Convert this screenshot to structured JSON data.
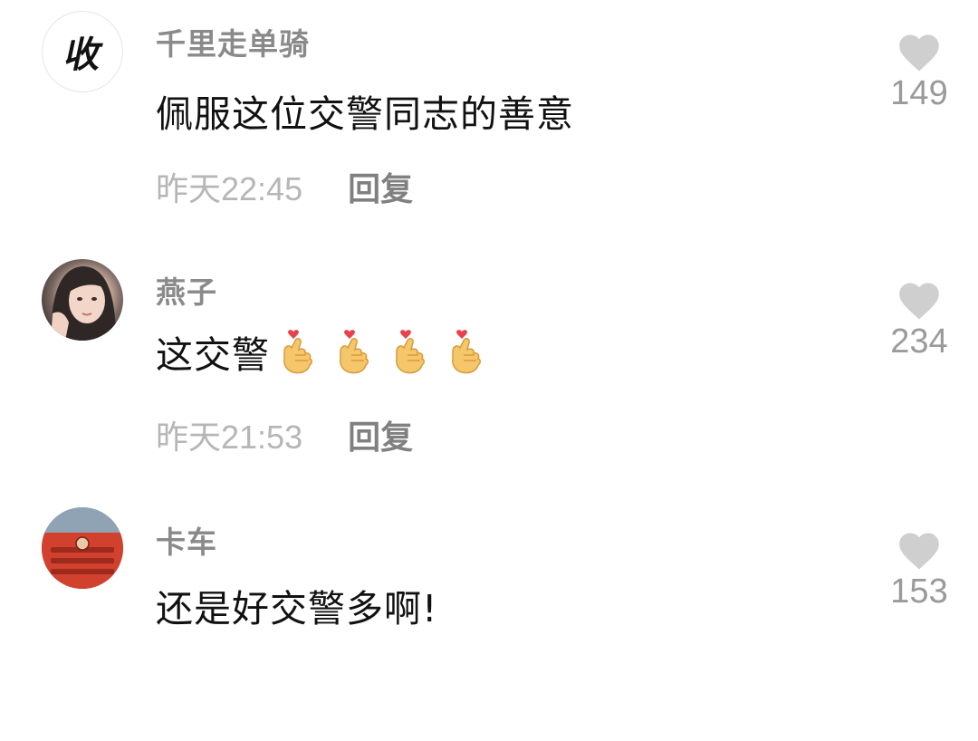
{
  "comments": [
    {
      "avatar_text": "收",
      "username": "千里走单骑",
      "content": "佩服这位交警同志的善意",
      "time": "昨天22:45",
      "reply_label": "回复",
      "likes": "149"
    },
    {
      "username": "燕子",
      "content": "这交警",
      "emojis": [
        "finger-heart-emoji",
        "finger-heart-emoji",
        "finger-heart-emoji",
        "finger-heart-emoji"
      ],
      "time": "昨天21:53",
      "reply_label": "回复",
      "likes": "234"
    },
    {
      "username": "卡车",
      "content": "还是好交警多啊!",
      "likes": "153"
    }
  ],
  "icons": {
    "like": "heart-icon"
  },
  "colors": {
    "heart": "#cfcfcf",
    "username": "#8a8a8a",
    "time": "#b6b6b6",
    "reply": "#808080",
    "content": "#111111"
  }
}
